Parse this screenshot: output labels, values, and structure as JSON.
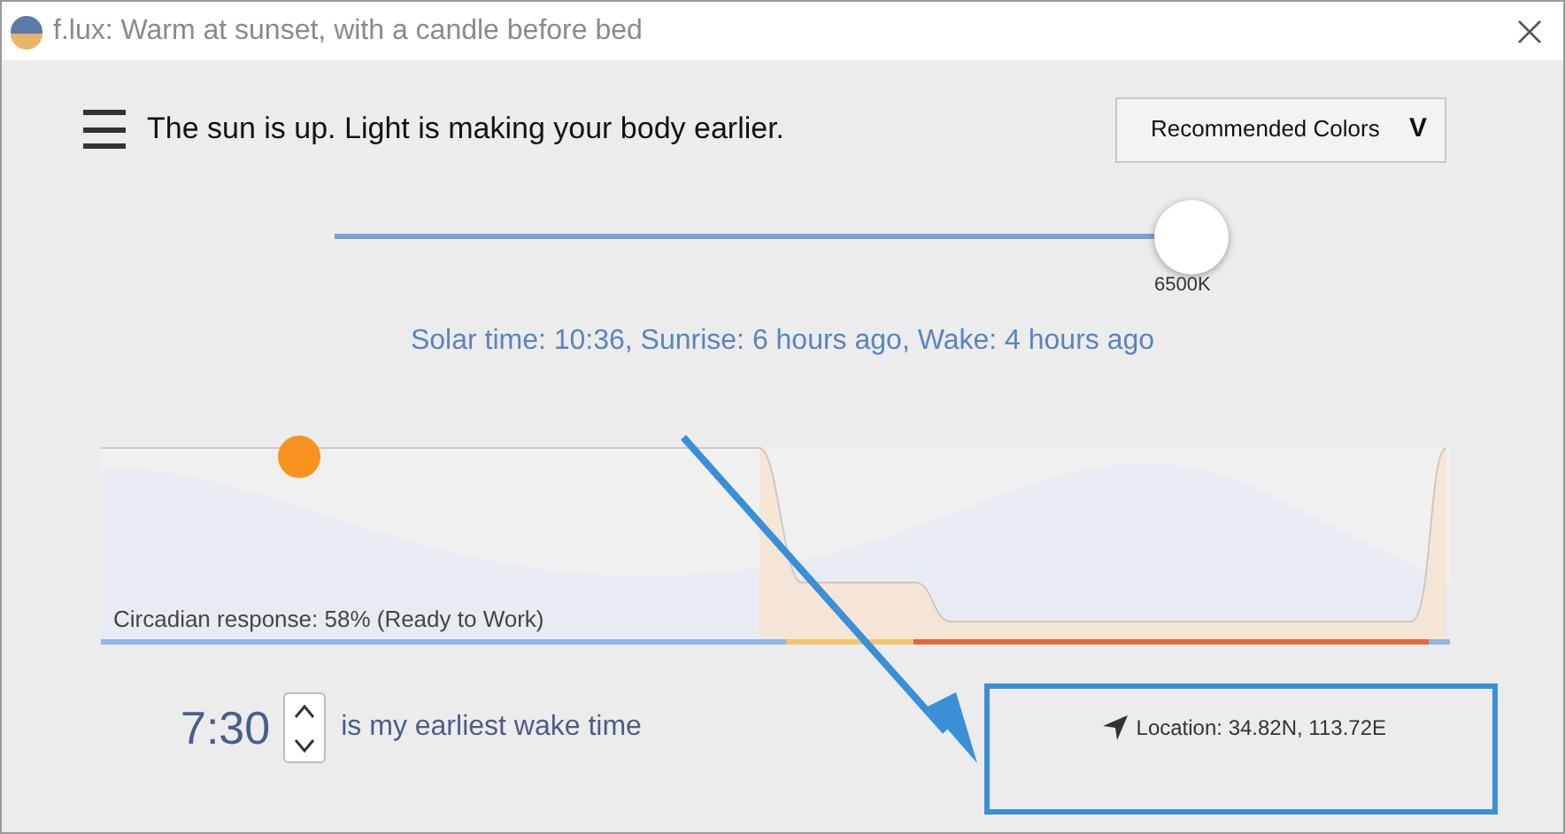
{
  "window": {
    "title": "f.lux: Warm at sunset, with a candle before bed"
  },
  "header": {
    "status": "The sun is up. Light is making your body earlier.",
    "dropdown": "Recommended Colors",
    "dropdown_caret": "V"
  },
  "slider": {
    "level": 1,
    "reading": "6500K"
  },
  "solar_info": "Solar time: 10:36, Sunrise: 6 hours ago, Wake: 4 hours ago",
  "timeline": {
    "caption": "Circadian response: 58% (Ready to Work)"
  },
  "wake": {
    "time": "7:30",
    "label": "is my earliest wake time"
  },
  "location": "Location: 34.82N, 113.72E"
}
